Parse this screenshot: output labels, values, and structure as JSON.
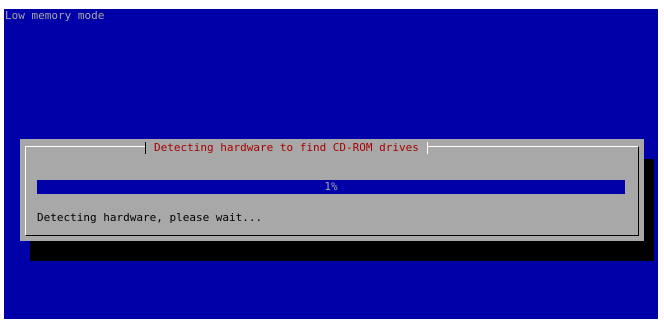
{
  "screen": {
    "mode_label": "Low memory mode"
  },
  "dialog": {
    "title": "Detecting hardware to find CD-ROM drives",
    "progress": {
      "percent_label": "1%",
      "fraction": 1.0
    },
    "message": "Detecting hardware, please wait..."
  },
  "colors": {
    "background": "#0000a8",
    "dialog": "#a8a8a8",
    "title": "#a80000",
    "progress_fill": "#0000a8",
    "shadow": "#000000"
  }
}
